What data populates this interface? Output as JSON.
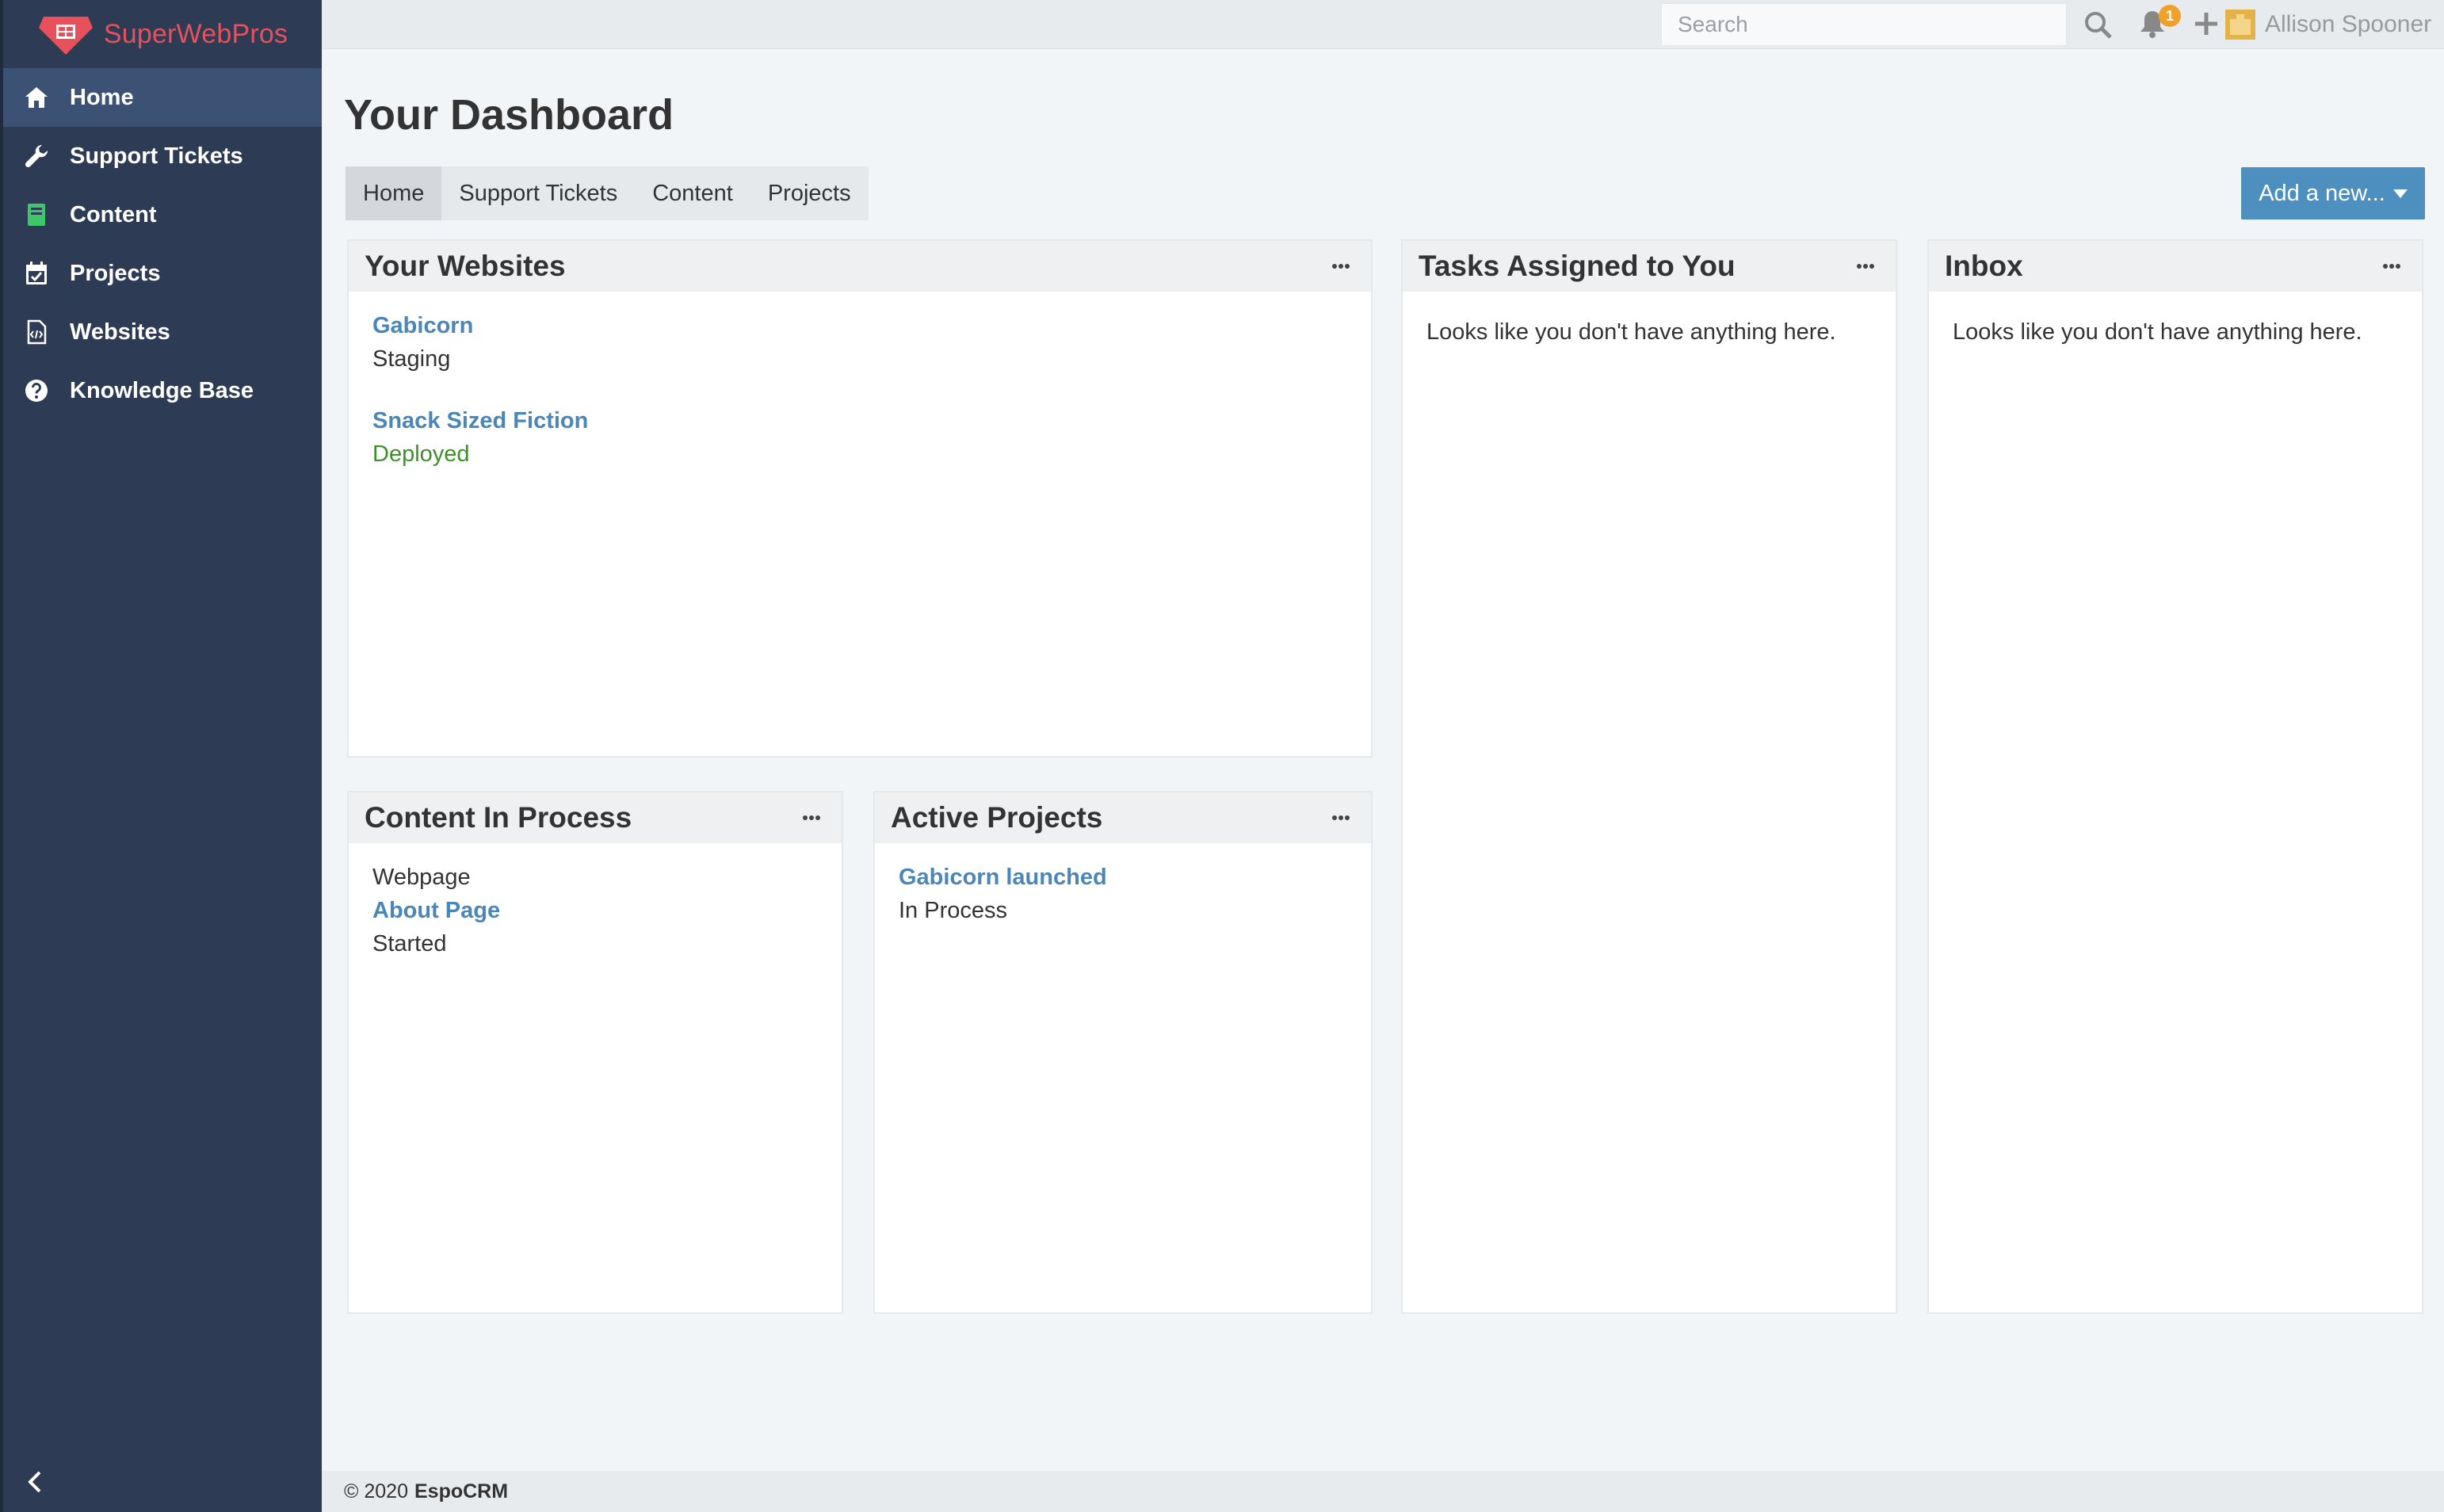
{
  "brand": {
    "name": "SuperWebPros",
    "color": "#e8505b"
  },
  "sidebar": {
    "items": [
      {
        "label": "Home",
        "icon": "home-icon",
        "active": true
      },
      {
        "label": "Support Tickets",
        "icon": "wrench-icon"
      },
      {
        "label": "Content",
        "icon": "book-icon"
      },
      {
        "label": "Projects",
        "icon": "calendar-check-icon"
      },
      {
        "label": "Websites",
        "icon": "file-code-icon"
      },
      {
        "label": "Knowledge Base",
        "icon": "question-circle-icon"
      }
    ]
  },
  "topbar": {
    "search_placeholder": "Search",
    "notification_count": "1",
    "user_name": "Allison Spooner"
  },
  "dashboard": {
    "title": "Your Dashboard",
    "tabs": [
      "Home",
      "Support Tickets",
      "Content",
      "Projects"
    ],
    "add_new_label": "Add a new..."
  },
  "panels": {
    "websites": {
      "title": "Your Websites",
      "items": [
        {
          "name": "Gabicorn",
          "status": "Staging"
        },
        {
          "name": "Snack Sized Fiction",
          "status": "Deployed"
        }
      ]
    },
    "tasks": {
      "title": "Tasks Assigned to You",
      "empty": "Looks like you don't have anything here."
    },
    "inbox": {
      "title": "Inbox",
      "empty": "Looks like you don't have anything here."
    },
    "content": {
      "title": "Content In Process",
      "item": {
        "type": "Webpage",
        "name": "About Page",
        "status": "Started"
      }
    },
    "projects": {
      "title": "Active Projects",
      "item": {
        "name": "Gabicorn launched",
        "status": "In Process"
      }
    }
  },
  "footer": {
    "copyright": "© 2020",
    "product": "EspoCRM"
  },
  "colors": {
    "sidebar": "#2e3b54",
    "active_item": "#3b5274",
    "accent": "#4d8fbf",
    "link": "#4a86b8",
    "deployed": "#3d8f2a"
  }
}
